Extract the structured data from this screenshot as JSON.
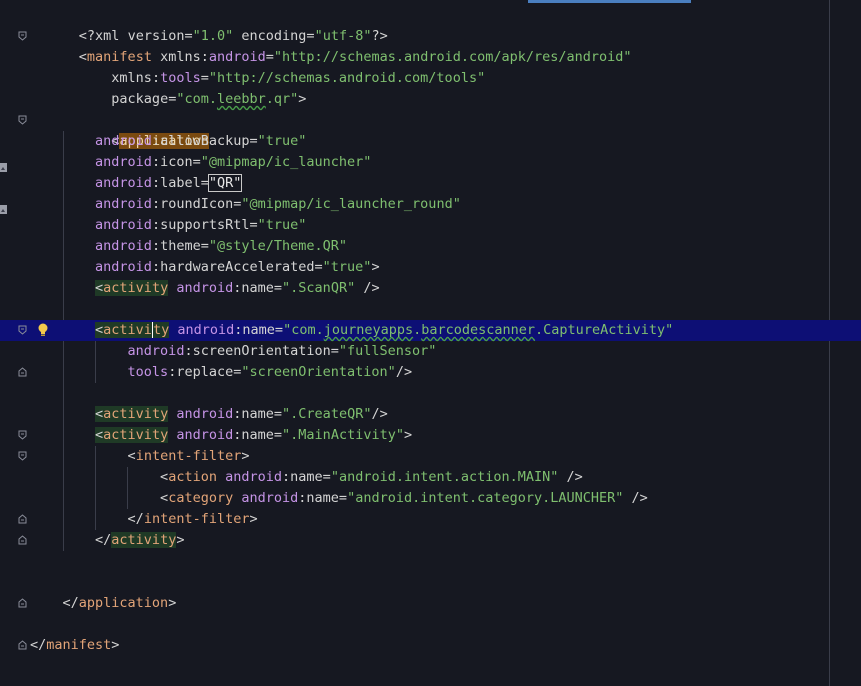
{
  "editor": {
    "file_language": "xml",
    "colors": {
      "background": "#161821",
      "current_line": "#0d0f75",
      "tag": "#e2a478",
      "namespace": "#c594e6",
      "value": "#7fbf6f",
      "text": "#d4d4d4"
    },
    "lines": {
      "l1": {
        "p1": "<?xml ",
        "a1": "version",
        "e1": "=",
        "v1": "\"1.0\"",
        "s1": " ",
        "a2": "encoding",
        "e2": "=",
        "v2": "\"utf-8\"",
        "p2": "?>"
      },
      "l2": {
        "p1": "<",
        "tag": "manifest",
        "s1": " ",
        "a1": "xmlns",
        "c1": ":",
        "ns1": "android",
        "e1": "=",
        "v1": "\"http://schemas.android.com/apk/res/android\""
      },
      "l3": {
        "indent": "    ",
        "a1": "xmlns",
        "c1": ":",
        "ns1": "tools",
        "e1": "=",
        "v1": "\"http://schemas.android.com/tools\""
      },
      "l4": {
        "indent": "    ",
        "a1": "package",
        "e1": "=",
        "v1a": "\"com.",
        "v1b": "leebbr",
        "v1c": ".qr\"",
        "p1": ">"
      },
      "l6": {
        "indent": "    ",
        "p1": "<",
        "tag": "application"
      },
      "l7": {
        "indent": "        ",
        "ns": "android",
        "c": ":",
        "attr": "allowBackup",
        "e": "=",
        "val": "\"true\""
      },
      "l8": {
        "indent": "        ",
        "ns": "android",
        "c": ":",
        "attr": "icon",
        "e": "=",
        "val": "\"@mipmap/ic_launcher\""
      },
      "l9": {
        "indent": "        ",
        "ns": "android",
        "c": ":",
        "attr": "label",
        "e": "=",
        "val": "\"QR\""
      },
      "l10": {
        "indent": "        ",
        "ns": "android",
        "c": ":",
        "attr": "roundIcon",
        "e": "=",
        "val": "\"@mipmap/ic_launcher_round\""
      },
      "l11": {
        "indent": "        ",
        "ns": "android",
        "c": ":",
        "attr": "supportsRtl",
        "e": "=",
        "val": "\"true\""
      },
      "l12": {
        "indent": "        ",
        "ns": "android",
        "c": ":",
        "attr": "theme",
        "e": "=",
        "val": "\"@style/Theme.QR\""
      },
      "l13": {
        "indent": "        ",
        "ns": "android",
        "c": ":",
        "attr": "hardwareAccelerated",
        "e": "=",
        "val": "\"true\"",
        "p": ">"
      },
      "l14": {
        "indent": "        ",
        "p1": "<",
        "tag": "activity",
        "s": " ",
        "ns": "android",
        "c": ":",
        "attr": "name",
        "e": "=",
        "val": "\".ScanQR\"",
        "p2": " />"
      },
      "l16": {
        "indent": "        ",
        "p1": "<",
        "tag_a": "activi",
        "tag_b": "ty",
        "s": " ",
        "ns": "android",
        "c": ":",
        "attr": "name",
        "e": "=",
        "v1": "\"com.",
        "v2": "journeyapps",
        "v3": ".",
        "v4": "barcodescanner",
        "v5": ".CaptureActivity\""
      },
      "l17": {
        "indent": "            ",
        "ns": "android",
        "c": ":",
        "attr": "screenOrientation",
        "e": "=",
        "val": "\"fullSensor\""
      },
      "l18": {
        "indent": "            ",
        "ns": "tools",
        "c": ":",
        "attr": "replace",
        "e": "=",
        "val": "\"screenOrientation\"",
        "p": "/>"
      },
      "l20": {
        "indent": "        ",
        "p1": "<",
        "tag": "activity",
        "s": " ",
        "ns": "android",
        "c": ":",
        "attr": "name",
        "e": "=",
        "val": "\".CreateQR\"",
        "p2": "/>"
      },
      "l21": {
        "indent": "        ",
        "p1": "<",
        "tag": "activity",
        "s": " ",
        "ns": "android",
        "c": ":",
        "attr": "name",
        "e": "=",
        "val": "\".MainActivity\"",
        "p2": ">"
      },
      "l22": {
        "indent": "            ",
        "p1": "<",
        "tag": "intent-filter",
        "p2": ">"
      },
      "l23": {
        "indent": "                ",
        "p1": "<",
        "tag": "action",
        "s": " ",
        "ns": "android",
        "c": ":",
        "attr": "name",
        "e": "=",
        "val": "\"android.intent.action.MAIN\"",
        "p2": " />"
      },
      "l24": {
        "indent": "                ",
        "p1": "<",
        "tag": "category",
        "s": " ",
        "ns": "android",
        "c": ":",
        "attr": "name",
        "e": "=",
        "val": "\"android.intent.category.LAUNCHER\"",
        "p2": " />"
      },
      "l25": {
        "indent": "            ",
        "p1": "</",
        "tag": "intent-filter",
        "p2": ">"
      },
      "l26": {
        "indent": "        ",
        "p1": "</",
        "tag": "activity",
        "p2": ">"
      },
      "l29": {
        "indent": "    ",
        "p1": "</",
        "tag": "application",
        "p2": ">"
      },
      "l31": {
        "p1": "</",
        "tag": "manifest",
        "p2": ">"
      }
    },
    "gutter_icons": {
      "fold": "fold-marker-icon",
      "image_preview": "image-preview-icon",
      "intention": "lightbulb-icon"
    }
  }
}
